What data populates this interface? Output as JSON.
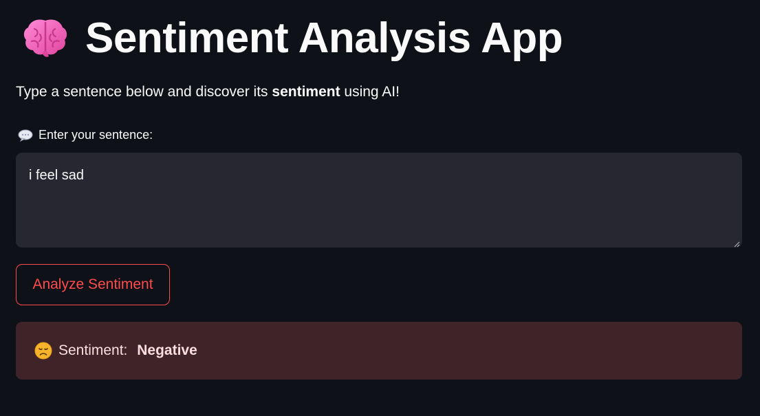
{
  "header": {
    "icon": "brain-icon",
    "title": "Sentiment Analysis App"
  },
  "intro": {
    "text_before": "Type a sentence below and discover its ",
    "text_bold": "sentiment",
    "text_after": " using AI!"
  },
  "input": {
    "icon": "speech-bubble-icon",
    "label": "Enter your sentence:",
    "value": "i feel sad"
  },
  "actions": {
    "analyze_label": "Analyze Sentiment"
  },
  "result": {
    "icon": "disappointed-face-icon",
    "label": "Sentiment: ",
    "value": "Negative"
  },
  "colors": {
    "background": "#0e1117",
    "input_background": "#262730",
    "accent": "#ff4b4b",
    "error_background": "#3e2329",
    "error_text": "#fcdede"
  }
}
